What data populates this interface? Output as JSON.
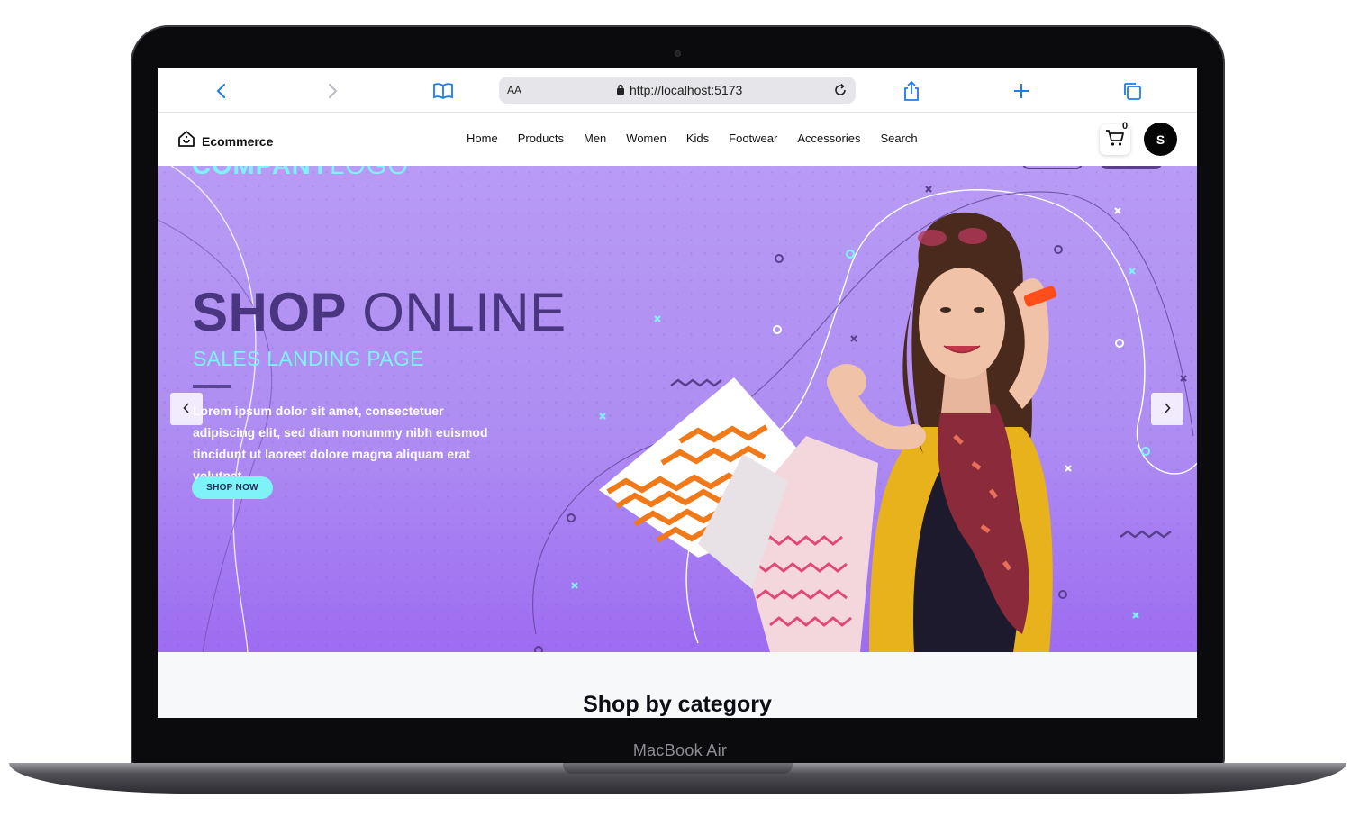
{
  "device": {
    "label": "MacBook Air"
  },
  "browser": {
    "text_size_label": "AA",
    "url": "http://localhost:5173",
    "icons": [
      "back-icon",
      "forward-icon",
      "bookmarks-icon",
      "lock-icon",
      "reload-icon",
      "share-icon",
      "new-tab-icon",
      "tabs-icon"
    ]
  },
  "nav": {
    "brand": "Ecommerce",
    "links": [
      "Home",
      "Products",
      "Men",
      "Women",
      "Kids",
      "Footwear",
      "Accessories",
      "Search"
    ],
    "cart_count": "0",
    "avatar_initial": "S"
  },
  "hero": {
    "logo_bold": "COMPANY",
    "logo_light": "LOGO",
    "title_bold": "SHOP",
    "title_light": "ONLINE",
    "subtitle": "SALES LANDING PAGE",
    "body": "Lorem ipsum dolor sit amet, consectetuer adipiscing elit, sed diam nonummy nibh euismod tincidunt ut laoreet dolore magna aliquam erat volutpat.",
    "cta": "SHOP NOW",
    "prev_label": "‹",
    "next_label": "›"
  },
  "category": {
    "title": "Shop by category"
  },
  "colors": {
    "hero_top": "#b89bf4",
    "hero_bottom": "#9d6cf1",
    "accent_cyan": "#7ff2f7",
    "title_purple": "#4a3580",
    "browser_blue": "#1c7cf0"
  }
}
